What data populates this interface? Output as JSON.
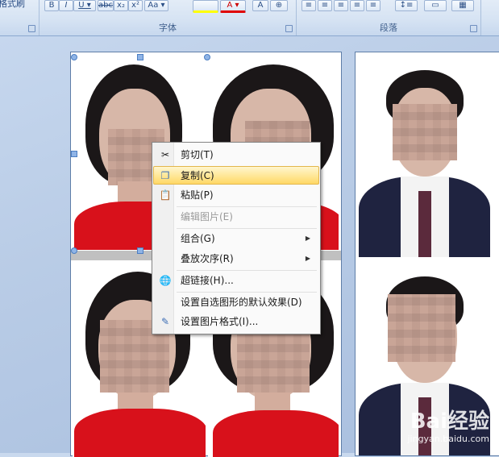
{
  "ribbon": {
    "cutoff_text": "格式刷",
    "font_group_label": "字体",
    "paragraph_group_label": "段落"
  },
  "context_menu": {
    "items": [
      {
        "label": "剪切(T)",
        "icon": "scissors-icon",
        "enabled": true,
        "submenu": false
      },
      {
        "label": "复制(C)",
        "icon": "copy-icon",
        "enabled": true,
        "submenu": false,
        "hover": true
      },
      {
        "label": "粘贴(P)",
        "icon": "paste-icon",
        "enabled": true,
        "submenu": false
      },
      {
        "label": "编辑图片(E)",
        "icon": "",
        "enabled": false,
        "submenu": false
      },
      {
        "label": "组合(G)",
        "icon": "",
        "enabled": true,
        "submenu": true
      },
      {
        "label": "叠放次序(R)",
        "icon": "",
        "enabled": true,
        "submenu": true
      },
      {
        "label": "超链接(H)...",
        "icon": "hyperlink-globe-icon",
        "enabled": true,
        "submenu": false
      },
      {
        "label": "设置自选图形的默认效果(D)",
        "icon": "",
        "enabled": true,
        "submenu": false
      },
      {
        "label": "设置图片格式(I)...",
        "icon": "format-picture-icon",
        "enabled": true,
        "submenu": false
      }
    ],
    "submenu_arrow": "▶"
  },
  "watermark": {
    "brand": "Bai经验",
    "url": "jingyan.baidu.com"
  },
  "colors": {
    "menu_hover": "#ffe89a",
    "ribbon_bg": "#d6e3f3",
    "doc_bg": "#b9cce6"
  }
}
